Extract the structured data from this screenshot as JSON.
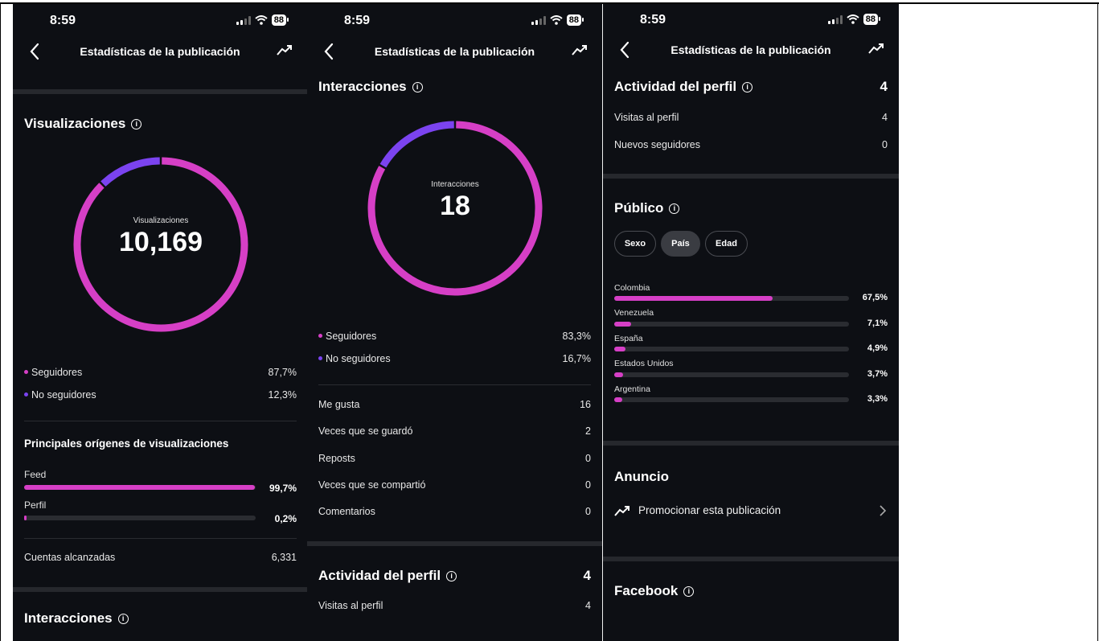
{
  "status_bar": {
    "time": "8:59",
    "battery": "88"
  },
  "nav": {
    "title": "Estadísticas de la publicación"
  },
  "colors": {
    "followers": "#d63fc6",
    "non_followers": "#7b43f0",
    "background": "#0d0f14"
  },
  "screen1": {
    "views_title": "Visualizaciones",
    "donut": {
      "label": "Visualizaciones",
      "value": "10,169",
      "followers_fraction": 0.877,
      "non_followers_fraction": 0.123
    },
    "legend": [
      {
        "label": "Seguidores",
        "value": "87,7%"
      },
      {
        "label": "No seguidores",
        "value": "12,3%"
      }
    ],
    "sources_title": "Principales orígenes de visualizaciones",
    "sources": [
      {
        "label": "Feed",
        "value": "99,7%",
        "fraction": 0.997
      },
      {
        "label": "Perfil",
        "value": "0,2%",
        "fraction": 0.002
      }
    ],
    "accounts_reached": {
      "label": "Cuentas alcanzadas",
      "value": "6,331"
    },
    "cut_title": "Interacciones"
  },
  "screen2": {
    "interactions_title": "Interacciones",
    "donut": {
      "label": "Interacciones",
      "value": "18",
      "followers_fraction": 0.833,
      "non_followers_fraction": 0.167
    },
    "legend": [
      {
        "label": "Seguidores",
        "value": "83,3%"
      },
      {
        "label": "No seguidores",
        "value": "16,7%"
      }
    ],
    "metrics": [
      {
        "label": "Me gusta",
        "value": "16"
      },
      {
        "label": "Veces que se guardó",
        "value": "2"
      },
      {
        "label": "Reposts",
        "value": "0"
      },
      {
        "label": "Veces que se compartió",
        "value": "0"
      },
      {
        "label": "Comentarios",
        "value": "0"
      }
    ],
    "profile_activity": {
      "title": "Actividad del perfil",
      "value": "4"
    },
    "profile_visits": {
      "label": "Visitas al perfil",
      "value": "4"
    }
  },
  "screen3": {
    "profile_activity": {
      "title": "Actividad del perfil",
      "value": "4"
    },
    "profile_rows": [
      {
        "label": "Visitas al perfil",
        "value": "4"
      },
      {
        "label": "Nuevos seguidores",
        "value": "0"
      }
    ],
    "audience_title": "Público",
    "tabs": [
      {
        "label": "Sexo",
        "active": false
      },
      {
        "label": "País",
        "active": true
      },
      {
        "label": "Edad",
        "active": false
      }
    ],
    "countries": [
      {
        "label": "Colombia",
        "value": "67,5%",
        "fraction": 0.675
      },
      {
        "label": "Venezuela",
        "value": "7,1%",
        "fraction": 0.071
      },
      {
        "label": "España",
        "value": "4,9%",
        "fraction": 0.049
      },
      {
        "label": "Estados Unidos",
        "value": "3,7%",
        "fraction": 0.037
      },
      {
        "label": "Argentina",
        "value": "3,3%",
        "fraction": 0.033
      }
    ],
    "ad_title": "Anuncio",
    "promote_label": "Promocionar esta publicación",
    "facebook_title": "Facebook"
  }
}
